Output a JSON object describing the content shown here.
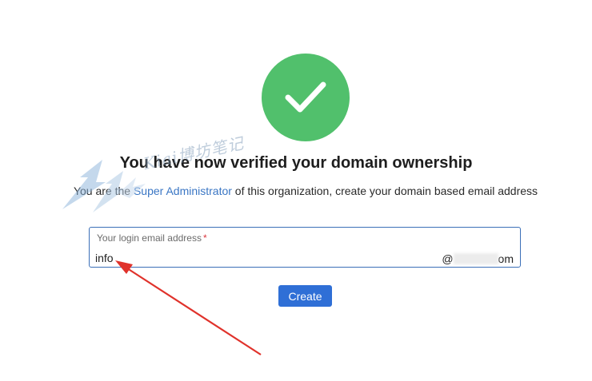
{
  "success": {
    "icon": "checkmark-icon",
    "color": "#51c06c"
  },
  "heading": {
    "title": "You have now verified your domain ownership",
    "subtitle_before": "You are the ",
    "subtitle_link": "Super Administrator",
    "subtitle_after": " of this organization, create your domain based email address"
  },
  "email_form": {
    "label": "Your login email address",
    "required_mark": "*",
    "value": "info",
    "domain_prefix": "@",
    "domain_suffix": "om",
    "border_color": "#3b6fb8"
  },
  "actions": {
    "create_label": "Create",
    "button_color": "#2f6fd6"
  },
  "watermark": {
    "text": "Kiai博坊笔记"
  },
  "annotation": {
    "arrow_color": "#e0322b"
  }
}
